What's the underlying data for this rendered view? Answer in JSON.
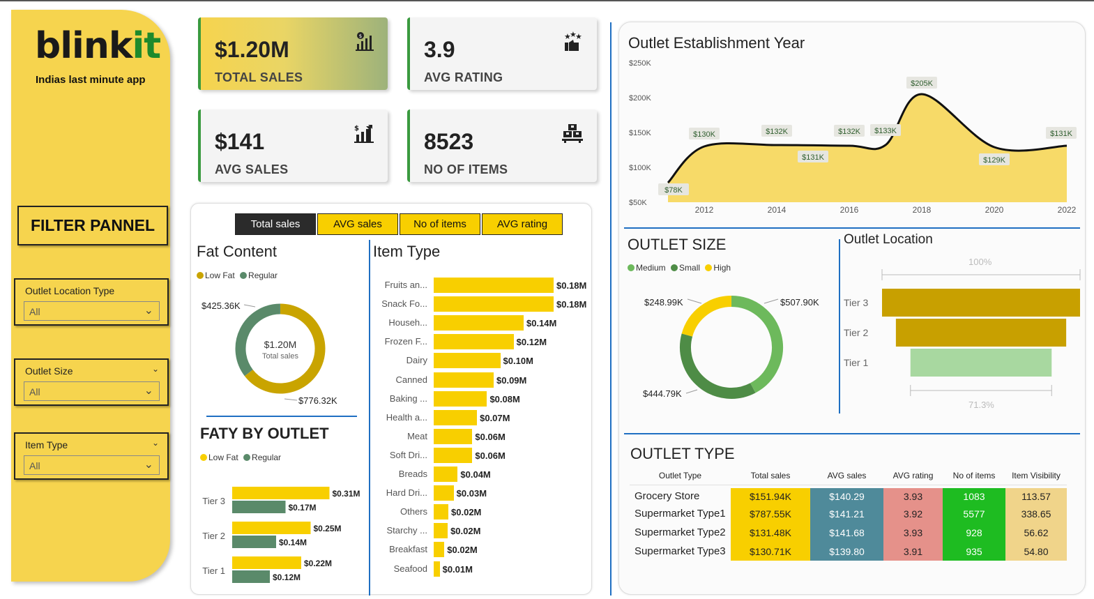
{
  "brand": {
    "logo_main": "blink",
    "logo_accent": "it",
    "tagline": "Indias last minute app",
    "accent_color": "#f6d44e",
    "logo_accent_color": "#1e8a2c"
  },
  "filters": {
    "title": "FILTER PANNEL",
    "slicers": [
      {
        "label": "Outlet Location Type",
        "value": "All"
      },
      {
        "label": "Outlet Size",
        "value": "All"
      },
      {
        "label": "Item Type",
        "value": "All"
      }
    ]
  },
  "kpis": [
    {
      "value": "$1.20M",
      "label": "TOTAL SALES",
      "icon": "sales-chart-icon"
    },
    {
      "value": "3.9",
      "label": "AVG RATING",
      "icon": "rating-stars-icon"
    },
    {
      "value": "$141",
      "label": "AVG SALES",
      "icon": "avg-sales-chart-icon"
    },
    {
      "value": "8523",
      "label": "NO OF ITEMS",
      "icon": "items-boxes-icon"
    }
  ],
  "tabs": [
    "Total sales",
    "AVG sales",
    "No of items",
    "AVG rating"
  ],
  "fat_content": {
    "title": "Fat Content",
    "legend": [
      "Low Fat",
      "Regular"
    ],
    "center_value": "$1.20M",
    "center_label": "Total sales",
    "label_regular": "$425.36K",
    "label_lowfat": "$776.32K"
  },
  "faty_by_outlet": {
    "title": "FATY BY OUTLET",
    "legend": [
      "Low Fat",
      "Regular"
    ]
  },
  "item_type_title": "Item Type",
  "outlet_year": {
    "title": "Outlet Establishment Year"
  },
  "outlet_size": {
    "title": "OUTLET SIZE",
    "legend": [
      "Medium",
      "Small",
      "High"
    ],
    "label_high": "$248.99K",
    "label_medium": "$507.90K",
    "label_small": "$444.79K"
  },
  "outlet_location": {
    "title": "Outlet Location",
    "top_pct": "100%",
    "bottom_pct": "71.3%"
  },
  "outlet_type": {
    "title": "OUTLET TYPE",
    "columns": [
      "Outlet Type",
      "Total sales",
      "AVG sales",
      "AVG rating",
      "No of items",
      "Item Visibility"
    ],
    "rows": [
      [
        "Grocery Store",
        "$151.94K",
        "$140.29",
        "3.93",
        "1083",
        "113.57"
      ],
      [
        "Supermarket Type1",
        "$787.55K",
        "$141.21",
        "3.92",
        "5577",
        "338.65"
      ],
      [
        "Supermarket Type2",
        "$131.48K",
        "$141.68",
        "3.93",
        "928",
        "56.62"
      ],
      [
        "Supermarket Type3",
        "$130.71K",
        "$139.80",
        "3.91",
        "935",
        "54.80"
      ]
    ]
  },
  "chart_data": [
    {
      "type": "pie",
      "title": "Fat Content",
      "categories": [
        "Low Fat",
        "Regular"
      ],
      "values": [
        776.32,
        425.36
      ],
      "data_labels": [
        "$776.32K",
        "$425.36K"
      ],
      "colors": [
        "#c9a400",
        "#5a8a6a"
      ],
      "legend": "top-left"
    },
    {
      "type": "bar",
      "title": "FATY BY OUTLET",
      "categories": [
        "Tier 3",
        "Tier 2",
        "Tier 1"
      ],
      "series": [
        {
          "name": "Low Fat",
          "values": [
            0.31,
            0.25,
            0.22
          ],
          "labels": [
            "$0.31M",
            "$0.25M",
            "$0.22M"
          ],
          "color": "#f8cf00"
        },
        {
          "name": "Regular",
          "values": [
            0.17,
            0.14,
            0.12
          ],
          "labels": [
            "$0.17M",
            "$0.14M",
            "$0.12M"
          ],
          "color": "#5a8a6a"
        }
      ],
      "legend": "top-left"
    },
    {
      "type": "bar",
      "title": "Item Type",
      "categories": [
        "Fruits an...",
        "Snack Fo...",
        "Househ...",
        "Frozen F...",
        "Dairy",
        "Canned",
        "Baking ...",
        "Health a...",
        "Meat",
        "Soft Dri...",
        "Breads",
        "Hard Dri...",
        "Others",
        "Starchy ...",
        "Breakfast",
        "Seafood"
      ],
      "values": [
        0.18,
        0.18,
        0.135,
        0.12,
        0.1,
        0.09,
        0.08,
        0.065,
        0.058,
        0.058,
        0.036,
        0.03,
        0.022,
        0.021,
        0.016,
        0.009
      ],
      "data_labels": [
        "$0.18M",
        "$0.18M",
        "$0.14M",
        "$0.12M",
        "$0.10M",
        "$0.09M",
        "$0.08M",
        "$0.07M",
        "$0.06M",
        "$0.06M",
        "$0.04M",
        "$0.03M",
        "$0.02M",
        "$0.02M",
        "$0.02M",
        "$0.01M"
      ],
      "color": "#f8cf00"
    },
    {
      "type": "area",
      "title": "Outlet Establishment Year",
      "x": [
        2011,
        2012,
        2014,
        2016,
        2017,
        2018,
        2020,
        2022
      ],
      "values": [
        78,
        130,
        132,
        131,
        132,
        205,
        129,
        131
      ],
      "points": [
        {
          "x": 2011,
          "y": 78,
          "label": "$78K"
        },
        {
          "x": 2012,
          "y": 130,
          "label": "$130K"
        },
        {
          "x": 2014,
          "y": 132,
          "label": "$132K"
        },
        {
          "x": 2015,
          "y": 131,
          "label": "$131K"
        },
        {
          "x": 2016,
          "y": 132,
          "label": "$132K"
        },
        {
          "x": 2017,
          "y": 133,
          "label": "$133K"
        },
        {
          "x": 2018,
          "y": 205,
          "label": "$205K"
        },
        {
          "x": 2020,
          "y": 129,
          "label": "$129K"
        },
        {
          "x": 2022,
          "y": 131,
          "label": "$131K"
        }
      ],
      "x_ticks": [
        "2012",
        "2014",
        "2016",
        "2018",
        "2020",
        "2022"
      ],
      "y_ticks": [
        "$50K",
        "$100K",
        "$150K",
        "$200K",
        "$250K"
      ],
      "ylim": [
        50,
        250
      ],
      "color": "#f6d44e"
    },
    {
      "type": "pie",
      "title": "OUTLET SIZE",
      "categories": [
        "Medium",
        "Small",
        "High"
      ],
      "values": [
        507.9,
        444.79,
        248.99
      ],
      "data_labels": [
        "$507.90K",
        "$444.79K",
        "$248.99K"
      ],
      "colors": [
        "#6db95c",
        "#4e8c46",
        "#f8cf00"
      ],
      "legend": "top-left"
    },
    {
      "type": "bar",
      "title": "Outlet Location",
      "categories": [
        "Tier 3",
        "Tier 2",
        "Tier 1"
      ],
      "values": [
        1.0,
        0.86,
        0.713
      ],
      "colors": [
        "#c8a000",
        "#c8a000",
        "#a8d8a0"
      ]
    }
  ]
}
